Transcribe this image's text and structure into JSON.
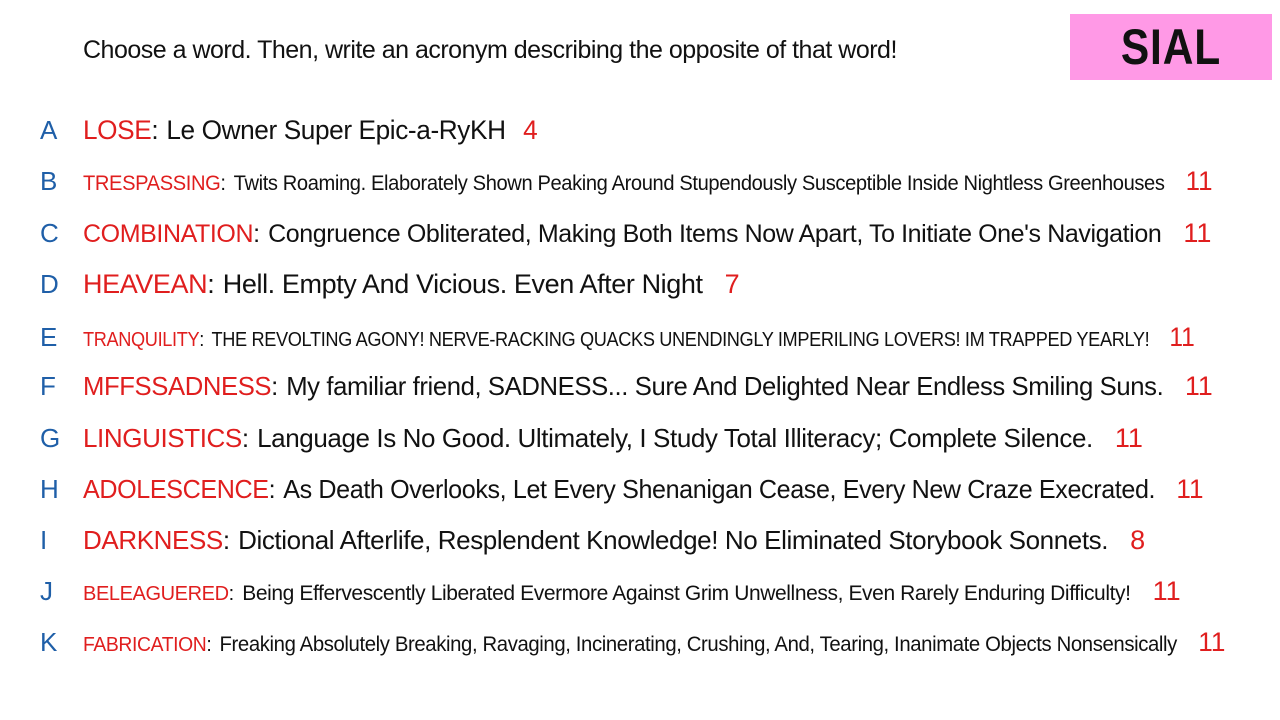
{
  "prompt": "Choose a word. Then, write an acronym describing the opposite of that word!",
  "badge": {
    "label": "SIAL",
    "color": "#ff99e6"
  },
  "colors": {
    "letter": "#1f5fa8",
    "word": "#e01e1e",
    "score": "#e01e1e",
    "text": "#111111"
  },
  "entries": [
    {
      "letter": "A",
      "word": "LOSE",
      "acronym": "Le Owner Super Epic-a-RyKH",
      "score": "4"
    },
    {
      "letter": "B",
      "word": "TRESPASSING",
      "acronym": "Twits Roaming. Elaborately Shown Peaking Around Stupendously Susceptible Inside Nightless Greenhouses",
      "score": "11"
    },
    {
      "letter": "C",
      "word": "COMBINATION",
      "acronym": "Congruence Obliterated, Making Both Items Now Apart, To Initiate One's Navigation",
      "score": "11"
    },
    {
      "letter": "D",
      "word": "HEAVEAN",
      "acronym": "Hell. Empty And Vicious. Even After Night",
      "score": "7"
    },
    {
      "letter": "E",
      "word": "TRANQUILITY",
      "acronym": "THE REVOLTING AGONY! NERVE-RACKING QUACKS UNENDINGLY IMPERILING LOVERS! IM TRAPPED YEARLY!",
      "score": "11"
    },
    {
      "letter": "F",
      "word": "MFFSSADNESS",
      "acronym": "My familiar friend, SADNESS... Sure And Delighted Near Endless Smiling Suns.",
      "score": "11"
    },
    {
      "letter": "G",
      "word": "LINGUISTICS",
      "acronym": "Language Is No Good. Ultimately, I Study Total Illiteracy; Complete Silence.",
      "score": "11"
    },
    {
      "letter": "H",
      "word": "ADOLESCENCE",
      "acronym": "As Death Overlooks, Let Every Shenanigan Cease, Every New Craze Execrated.",
      "score": "11"
    },
    {
      "letter": "I",
      "word": "DARKNESS",
      "acronym": "Dictional Afterlife, Resplendent Knowledge! No Eliminated Storybook Sonnets.",
      "score": "8"
    },
    {
      "letter": "J",
      "word": "BELEAGUERED",
      "acronym": "Being Effervescently Liberated Evermore Against Grim Unwellness, Even Rarely Enduring Difficulty!",
      "score": "11"
    },
    {
      "letter": "K",
      "word": "FABRICATION",
      "acronym": "Freaking Absolutely Breaking, Ravaging, Incinerating, Crushing, And, Tearing, Inanimate Objects Nonsensically",
      "score": "11"
    }
  ]
}
